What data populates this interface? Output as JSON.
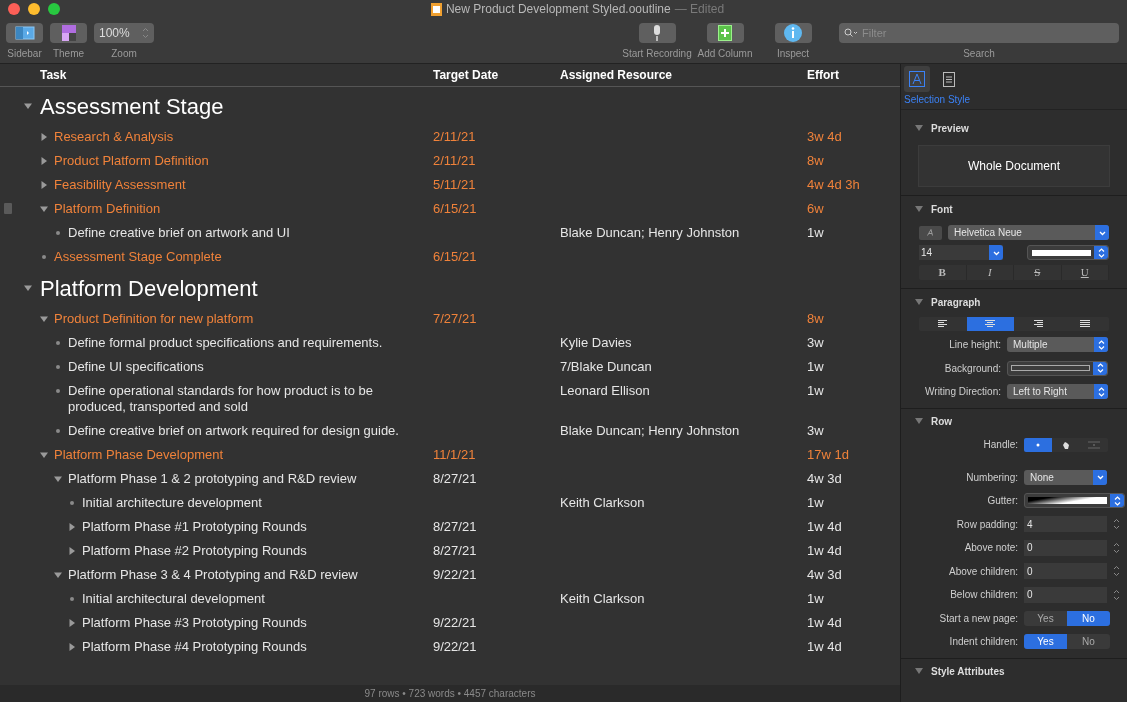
{
  "window": {
    "title": "New Product Development Styled.ooutline",
    "status": "— Edited"
  },
  "toolbar": {
    "left": [
      {
        "kind": "sidebar",
        "label": "Sidebar"
      },
      {
        "kind": "theme",
        "label": "Theme"
      }
    ],
    "zoom": {
      "value": "100%",
      "label": "Zoom"
    },
    "right": [
      {
        "kind": "mic",
        "label": "Start Recording"
      },
      {
        "kind": "add",
        "label": "Add Column"
      },
      {
        "kind": "info",
        "label": "Inspect"
      }
    ],
    "search": {
      "placeholder": "Filter",
      "label": "Search"
    }
  },
  "outline": {
    "columns": [
      "Task",
      "Target Date",
      "Assigned Resource",
      "Effort"
    ],
    "rows": [
      {
        "kind": "section",
        "text": "Assessment Stage",
        "expanded": true,
        "children": [
          {
            "kind": "parent",
            "text": "Research & Analysis",
            "date": "2/11/21",
            "effort": "3w 4d",
            "highlighted": true,
            "expanded": false
          },
          {
            "kind": "parent",
            "text": "Product Platform Definition",
            "date": "2/11/21",
            "effort": "8w",
            "highlighted": true,
            "expanded": false
          },
          {
            "kind": "parent",
            "text": "Feasibility Assessment",
            "date": "5/11/21",
            "effort": "4w 4d 3h",
            "highlighted": true,
            "expanded": false
          },
          {
            "kind": "parent",
            "text": "Platform Definition",
            "date": "6/15/21",
            "effort": "6w",
            "highlighted": true,
            "expanded": true,
            "handle": true,
            "children": [
              {
                "kind": "leaf",
                "text": "Define creative brief on artwork and UI",
                "resource": "Blake Duncan; Henry Johnston",
                "effort": "1w",
                "highlighted": false
              }
            ]
          },
          {
            "kind": "leaf",
            "text": "Assessment Stage Complete",
            "date": "6/15/21",
            "highlighted": true
          }
        ]
      },
      {
        "kind": "section",
        "text": "Platform Development",
        "expanded": true,
        "children": [
          {
            "kind": "parent",
            "text": "Product Definition for new platform",
            "date": "7/27/21",
            "effort": "8w",
            "highlighted": true,
            "expanded": true,
            "children": [
              {
                "kind": "leaf",
                "text": "Define formal product specifications and requirements.",
                "resource": "Kylie Davies",
                "effort": "3w",
                "highlighted": false
              },
              {
                "kind": "leaf",
                "text": "Define UI specifications",
                "resource": "7/Blake Duncan",
                "effort": "1w",
                "highlighted": false
              },
              {
                "kind": "leaf",
                "text": "Define operational standards for how product is to be produced, transported and sold",
                "resource": "Leonard Ellison",
                "effort": "1w",
                "highlighted": false
              },
              {
                "kind": "leaf",
                "text": "Define creative brief on artwork required for design guide.",
                "resource": "Blake Duncan; Henry Johnston",
                "effort": "3w",
                "highlighted": false
              }
            ]
          },
          {
            "kind": "parent",
            "text": "Platform Phase Development",
            "date": "11/1/21",
            "effort": "17w 1d",
            "highlighted": true,
            "expanded": true,
            "children": [
              {
                "kind": "parent",
                "text": "Platform Phase 1 & 2 prototyping and R&D review",
                "date": "8/27/21",
                "effort": "4w 3d",
                "highlighted": false,
                "expanded": true,
                "children": [
                  {
                    "kind": "leaf",
                    "text": "Initial architecture development",
                    "resource": "Keith Clarkson",
                    "effort": "1w",
                    "highlighted": false
                  },
                  {
                    "kind": "parent",
                    "text": "Platform Phase #1 Prototyping Rounds",
                    "date": "8/27/21",
                    "effort": "1w 4d",
                    "highlighted": false,
                    "expanded": false
                  },
                  {
                    "kind": "parent",
                    "text": "Platform Phase #2 Prototyping Rounds",
                    "date": "8/27/21",
                    "effort": "1w 4d",
                    "highlighted": false,
                    "expanded": false
                  }
                ]
              },
              {
                "kind": "parent",
                "text": "Platform Phase 3 & 4 Prototyping and R&D review",
                "date": "9/22/21",
                "effort": "4w 3d",
                "highlighted": false,
                "expanded": true,
                "children": [
                  {
                    "kind": "leaf",
                    "text": "Initial architectural development",
                    "resource": "Keith Clarkson",
                    "effort": "1w",
                    "highlighted": false
                  },
                  {
                    "kind": "parent",
                    "text": "Platform Phase #3 Prototyping Rounds",
                    "date": "9/22/21",
                    "effort": "1w 4d",
                    "highlighted": false,
                    "expanded": false
                  },
                  {
                    "kind": "parent",
                    "text": "Platform Phase #4 Prototyping Rounds",
                    "date": "9/22/21",
                    "effort": "1w 4d",
                    "highlighted": false,
                    "expanded": false
                  }
                ]
              }
            ]
          }
        ]
      }
    ]
  },
  "status_bar": "97 rows • 723 words • 4457 characters",
  "inspector": {
    "tabs": [
      {
        "kind": "text-style",
        "selected": true
      },
      {
        "kind": "document",
        "selected": false
      }
    ],
    "tab_label": "Selection Style",
    "preview": {
      "title": "Preview",
      "text": "Whole Document"
    },
    "font": {
      "title": "Font",
      "family": "Helvetica Neue",
      "size": "14",
      "styles": [
        {
          "kind": "bold",
          "text": "B"
        },
        {
          "kind": "italic",
          "text": "I"
        },
        {
          "kind": "strike",
          "text": "S"
        },
        {
          "kind": "underline",
          "text": "U"
        }
      ]
    },
    "paragraph": {
      "title": "Paragraph",
      "alignments": [
        {
          "kind": "left",
          "selected": false
        },
        {
          "kind": "center",
          "selected": true
        },
        {
          "kind": "right",
          "selected": false
        },
        {
          "kind": "justify",
          "selected": false
        }
      ],
      "fields": [
        {
          "kind": "popup",
          "label": "Line height:",
          "value": "Multiple"
        },
        {
          "kind": "swatch",
          "label": "Background:"
        },
        {
          "kind": "popup",
          "label": "Writing Direction:",
          "value": "Left to Right"
        }
      ]
    },
    "row": {
      "title": "Row",
      "handle": {
        "label": "Handle:",
        "options": [
          {
            "kind": "dot",
            "selected": true
          },
          {
            "kind": "hand",
            "selected": false
          },
          {
            "kind": "line",
            "selected": false
          }
        ]
      },
      "fields": [
        {
          "kind": "dropdown",
          "label": "Numbering:",
          "value": "None"
        },
        {
          "kind": "gradient",
          "label": "Gutter:"
        },
        {
          "kind": "stepper",
          "label": "Row padding:",
          "value": "4"
        },
        {
          "kind": "stepper",
          "label": "Above note:",
          "value": "0"
        },
        {
          "kind": "stepper",
          "label": "Above children:",
          "value": "0"
        },
        {
          "kind": "stepper",
          "label": "Below children:",
          "value": "0"
        },
        {
          "kind": "toggle",
          "label": "Start a new page:",
          "options": [
            {
              "text": "Yes",
              "selected": false
            },
            {
              "text": "No",
              "selected": true
            }
          ]
        },
        {
          "kind": "toggle",
          "label": "Indent children:",
          "options": [
            {
              "text": "Yes",
              "selected": true
            },
            {
              "text": "No",
              "selected": false
            }
          ]
        }
      ]
    },
    "style_attributes": {
      "title": "Style Attributes"
    }
  }
}
